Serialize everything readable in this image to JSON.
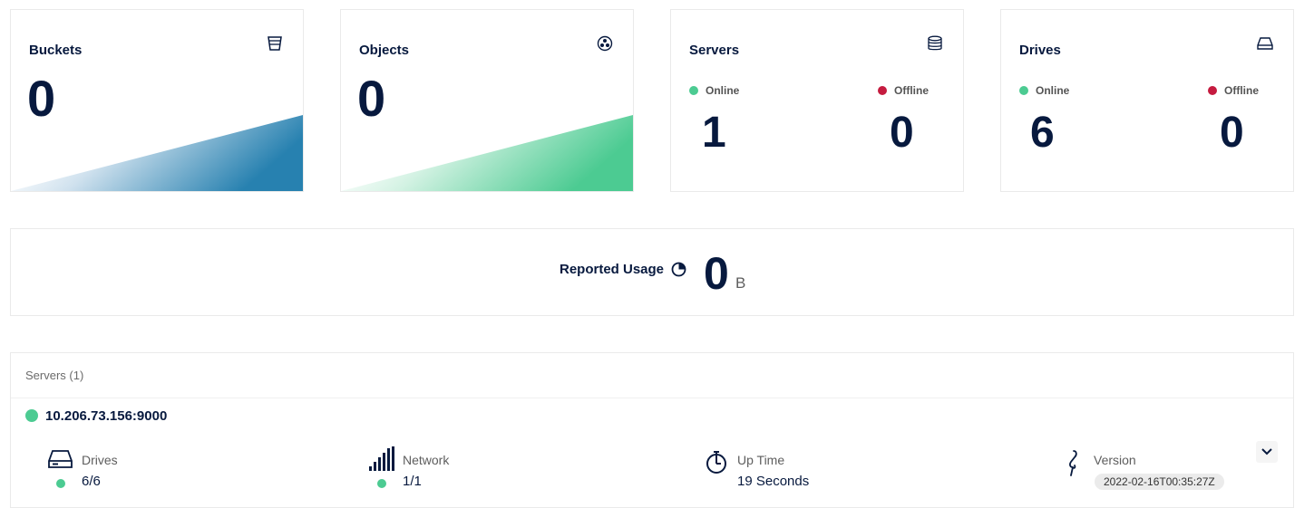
{
  "cards": {
    "buckets": {
      "title": "Buckets",
      "value": "0",
      "icon": "bucket-icon"
    },
    "objects": {
      "title": "Objects",
      "value": "0",
      "icon": "objects-icon"
    },
    "servers": {
      "title": "Servers",
      "online_label": "Online",
      "offline_label": "Offline",
      "online": "1",
      "offline": "0",
      "icon": "database-icon"
    },
    "drives": {
      "title": "Drives",
      "online_label": "Online",
      "offline_label": "Offline",
      "online": "6",
      "offline": "0",
      "icon": "drive-icon"
    }
  },
  "usage": {
    "label": "Reported Usage",
    "value": "0",
    "unit": "B",
    "icon": "pie-chart-icon"
  },
  "servers_panel": {
    "title": "Servers (1)",
    "server": {
      "address": "10.206.73.156:9000",
      "drives_label": "Drives",
      "drives_value": "6/6",
      "network_label": "Network",
      "network_value": "1/1",
      "uptime_label": "Up Time",
      "uptime_value": "19 Seconds",
      "version_label": "Version",
      "version_value": "2022-02-16T00:35:27Z"
    }
  },
  "colors": {
    "online": "#4ccb92",
    "offline": "#c51b3f",
    "primary": "#07193e",
    "buckets_gradient": "#2781b0",
    "objects_gradient": "#4ccb92"
  }
}
